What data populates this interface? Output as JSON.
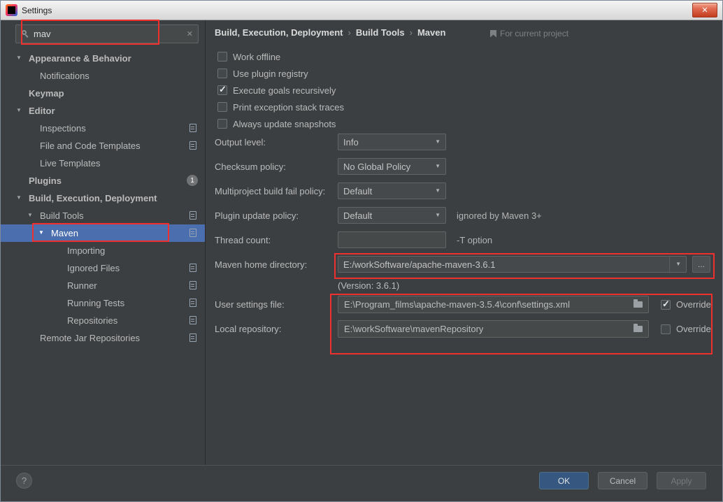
{
  "window": {
    "title": "Settings"
  },
  "icons": {
    "close": "✕",
    "clear": "✕",
    "chevron_down": "▼",
    "combo_arrow": "▼",
    "breadcrumb_sep": "›"
  },
  "sidebar": {
    "search": {
      "value": "mav"
    },
    "tree": [
      {
        "label": "Appearance & Behavior",
        "expanded": true,
        "bold": true
      },
      {
        "label": "Notifications"
      },
      {
        "label": "Keymap",
        "bold": true
      },
      {
        "label": "Editor",
        "expanded": true,
        "bold": true
      },
      {
        "label": "Inspections"
      },
      {
        "label": "File and Code Templates"
      },
      {
        "label": "Live Templates"
      },
      {
        "label": "Plugins",
        "bold": true,
        "badge": "1"
      },
      {
        "label": "Build, Execution, Deployment",
        "expanded": true,
        "bold": true
      },
      {
        "label": "Build Tools",
        "expanded": true
      },
      {
        "label": "Maven",
        "expanded": true,
        "selected": true
      },
      {
        "label": "Importing"
      },
      {
        "label": "Ignored Files"
      },
      {
        "label": "Runner"
      },
      {
        "label": "Running Tests"
      },
      {
        "label": "Repositories"
      },
      {
        "label": "Remote Jar Repositories"
      }
    ]
  },
  "main": {
    "breadcrumb": {
      "items": [
        "Build, Execution, Deployment",
        "Build Tools",
        "Maven"
      ],
      "scope": "For current project"
    },
    "checkboxes": [
      {
        "label": "Work offline",
        "checked": false
      },
      {
        "label": "Use plugin registry",
        "checked": false
      },
      {
        "label": "Execute goals recursively",
        "checked": true
      },
      {
        "label": "Print exception stack traces",
        "checked": false
      },
      {
        "label": "Always update snapshots",
        "checked": false
      }
    ],
    "rows": [
      {
        "label": "Output level:",
        "value": "Info"
      },
      {
        "label": "Checksum policy:",
        "value": "No Global Policy"
      },
      {
        "label": "Multiproject build fail policy:",
        "value": "Default"
      },
      {
        "label": "Plugin update policy:",
        "value": "Default",
        "hint": "ignored by Maven 3+"
      },
      {
        "label": "Thread count:",
        "value": "",
        "hint": "-T option"
      }
    ],
    "maven_home": {
      "label": "Maven home directory:",
      "value": "E:/workSoftware/apache-maven-3.6.1",
      "browse": "...",
      "version": "(Version: 3.6.1)"
    },
    "user_settings": {
      "label": "User settings file:",
      "value": "E:\\Program_films\\apache-maven-3.5.4\\conf\\settings.xml",
      "override_label": "Override",
      "override_checked": true
    },
    "local_repository": {
      "label": "Local repository:",
      "value": "E:\\workSoftware\\mavenRepository",
      "override_label": "Override",
      "override_checked": false
    }
  },
  "footer": {
    "help": "?",
    "ok": "OK",
    "cancel": "Cancel",
    "apply": "Apply"
  }
}
